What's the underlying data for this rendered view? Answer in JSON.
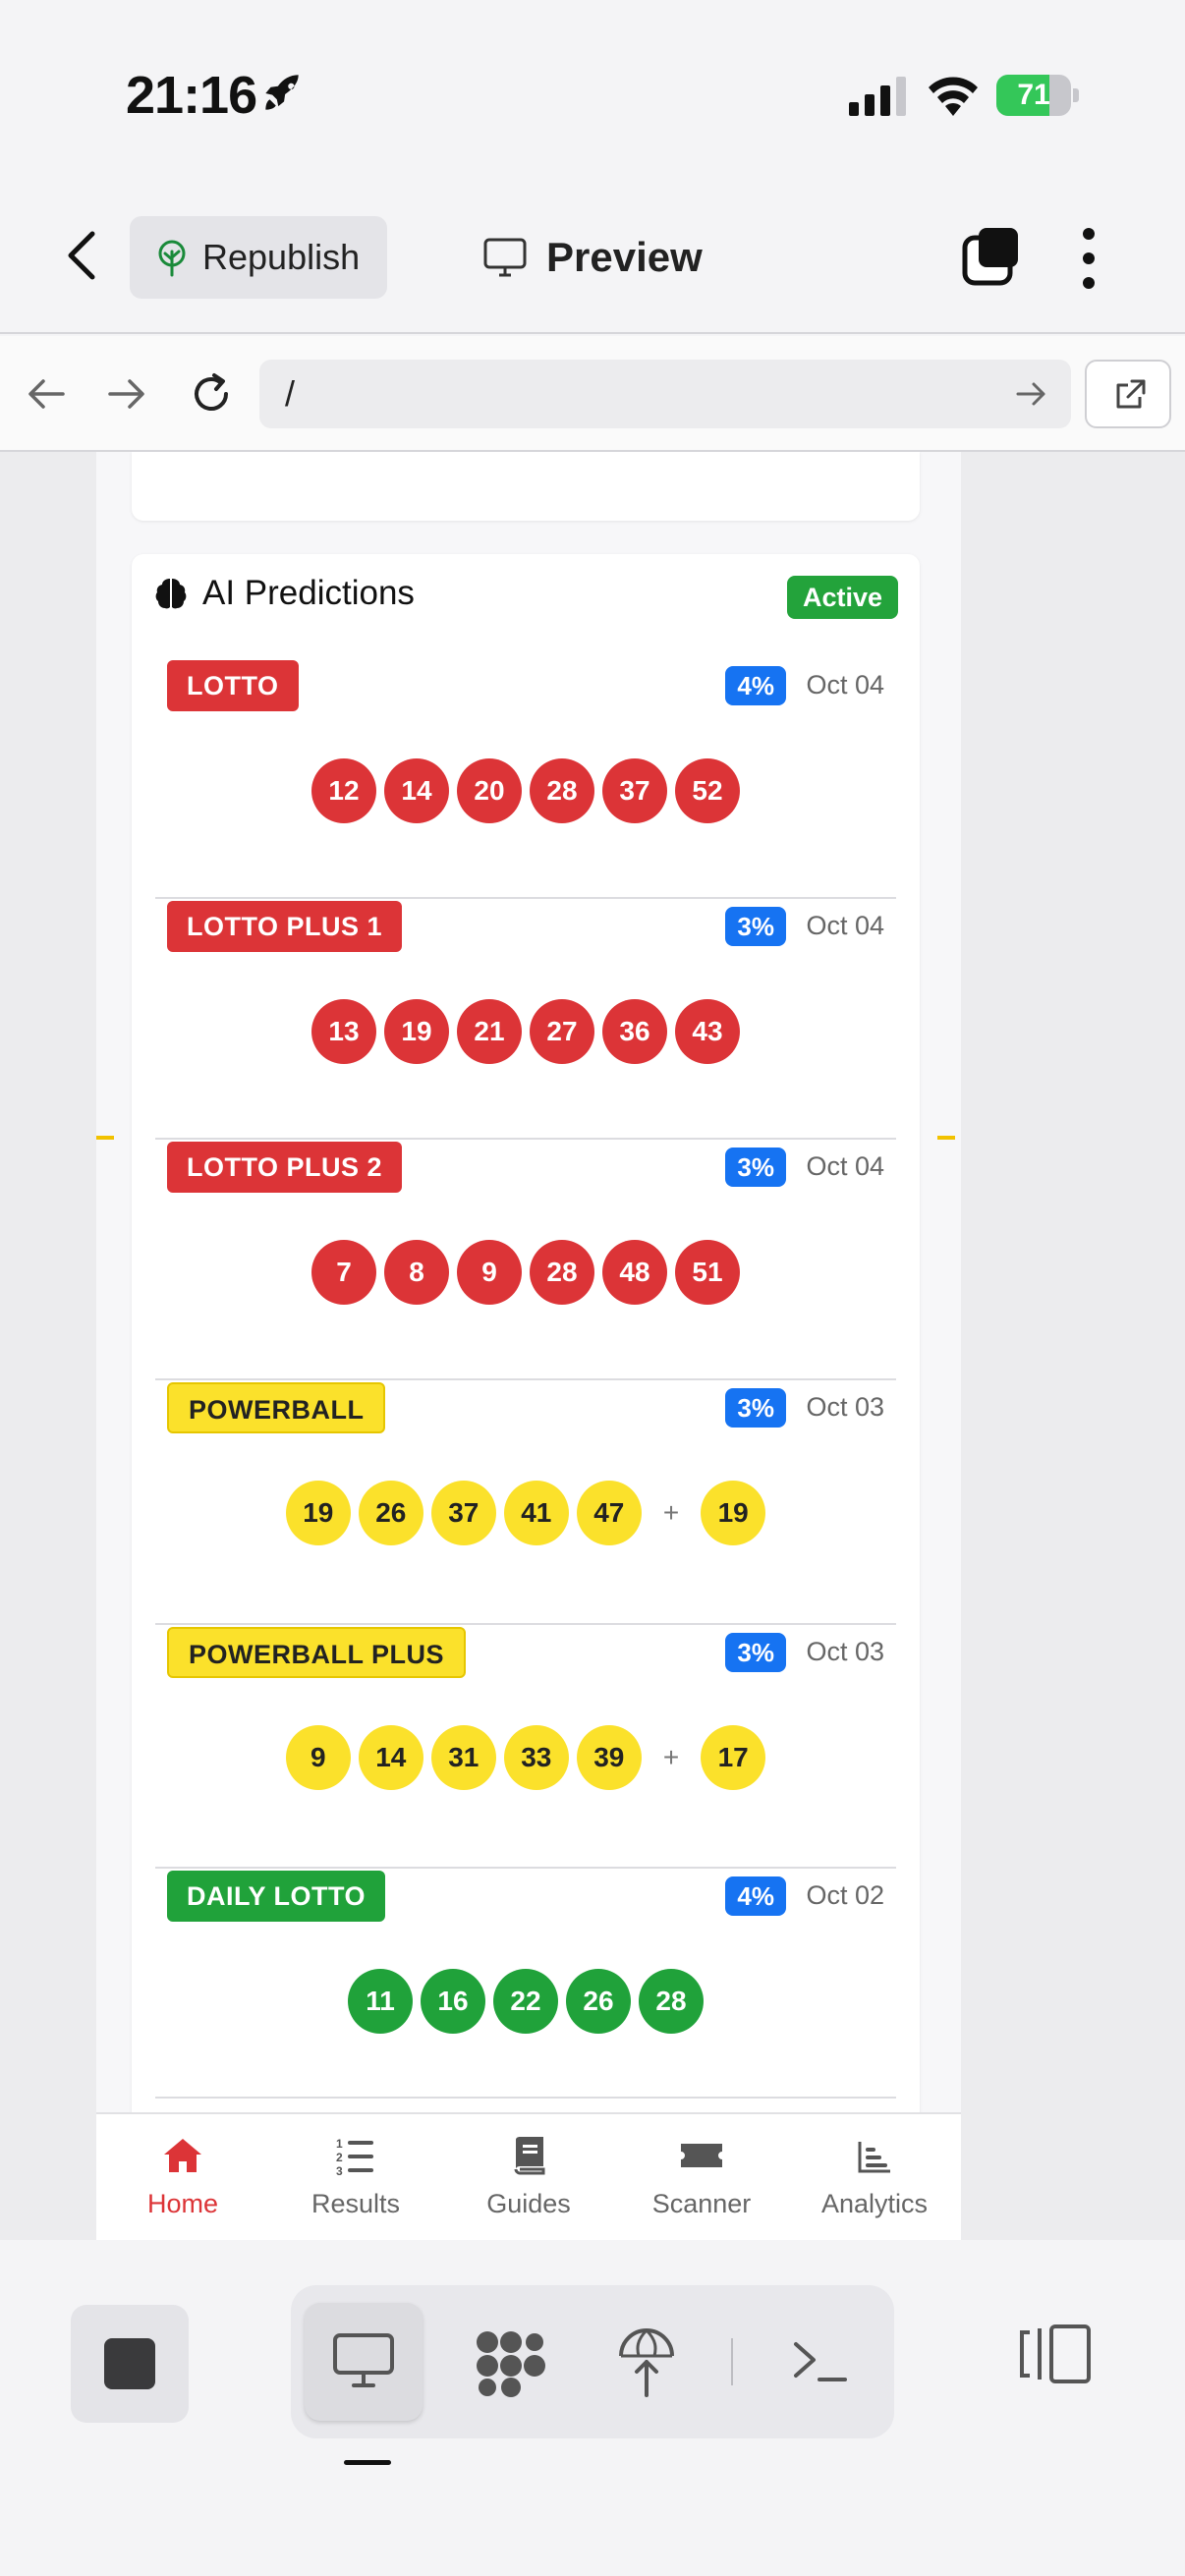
{
  "status_bar": {
    "time": "21:16",
    "battery": "71",
    "battery_level": 0.71
  },
  "header": {
    "republish_label": "Republish",
    "preview_label": "Preview"
  },
  "browser": {
    "url": "/"
  },
  "predictions": {
    "title": "AI Predictions",
    "status": "Active",
    "games": [
      {
        "name": "LOTTO",
        "pct": "4%",
        "date": "Oct 04",
        "color": "red",
        "numbers": [
          "12",
          "14",
          "20",
          "28",
          "37",
          "52"
        ],
        "bonus": null
      },
      {
        "name": "LOTTO PLUS 1",
        "pct": "3%",
        "date": "Oct 04",
        "color": "red",
        "numbers": [
          "13",
          "19",
          "21",
          "27",
          "36",
          "43"
        ],
        "bonus": null
      },
      {
        "name": "LOTTO PLUS 2",
        "pct": "3%",
        "date": "Oct 04",
        "color": "red",
        "numbers": [
          "7",
          "8",
          "9",
          "28",
          "48",
          "51"
        ],
        "bonus": null
      },
      {
        "name": "POWERBALL",
        "pct": "3%",
        "date": "Oct 03",
        "color": "yellow",
        "numbers": [
          "19",
          "26",
          "37",
          "41",
          "47"
        ],
        "bonus": "19"
      },
      {
        "name": "POWERBALL PLUS",
        "pct": "3%",
        "date": "Oct 03",
        "color": "yellow",
        "numbers": [
          "9",
          "14",
          "31",
          "33",
          "39"
        ],
        "bonus": "17"
      },
      {
        "name": "DAILY LOTTO",
        "pct": "4%",
        "date": "Oct 02",
        "color": "green",
        "numbers": [
          "11",
          "16",
          "22",
          "26",
          "28"
        ],
        "bonus": null
      }
    ],
    "plus_sign": "+"
  },
  "webnav": {
    "items": [
      {
        "label": "Home",
        "icon": "home-icon",
        "active": true
      },
      {
        "label": "Results",
        "icon": "numbered-list-icon",
        "active": false
      },
      {
        "label": "Guides",
        "icon": "book-icon",
        "active": false
      },
      {
        "label": "Scanner",
        "icon": "ticket-icon",
        "active": false
      },
      {
        "label": "Analytics",
        "icon": "bar-chart-icon",
        "active": false
      }
    ]
  },
  "colors": {
    "red": "#dc3437",
    "yellow": "#fbe12b",
    "green": "#20a23a",
    "blue": "#1673f2"
  }
}
